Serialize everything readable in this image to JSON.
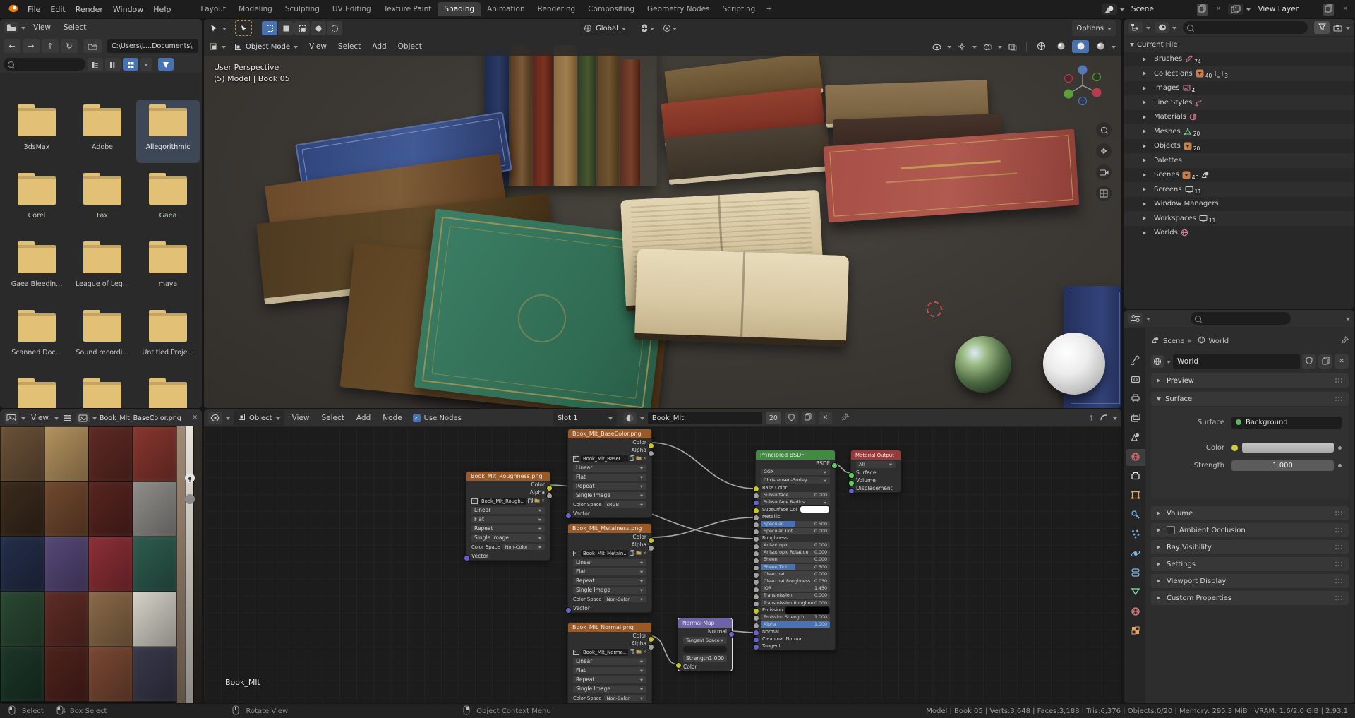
{
  "topbar": {
    "menus": [
      "File",
      "Edit",
      "Render",
      "Window",
      "Help"
    ],
    "workspaces": [
      "Layout",
      "Modeling",
      "Sculpting",
      "UV Editing",
      "Texture Paint",
      "Shading",
      "Animation",
      "Rendering",
      "Compositing",
      "Geometry Nodes",
      "Scripting"
    ],
    "active_workspace": "Shading",
    "add_workspace": "+",
    "scene_value": "Scene",
    "view_layer_value": "View Layer"
  },
  "file_browser": {
    "menus": [
      "View",
      "Select"
    ],
    "path": "C:\\Users\\L...Documents\\",
    "folders": [
      "3dsMax",
      "Adobe",
      "Allegorithmic",
      "Corel",
      "Fax",
      "Gaea",
      "Gaea Bleedin...",
      "League of Leg...",
      "maya",
      "Scanned Doc...",
      "Sound recordi...",
      "Untitled Proje..."
    ],
    "selected_folder": "Allegorithmic",
    "partial_row_count": 3
  },
  "viewport": {
    "mode": "Object Mode",
    "menus": [
      "View",
      "Select",
      "Add",
      "Object"
    ],
    "orientation": "Global",
    "options": "Options",
    "overlay_line1": "User Perspective",
    "overlay_line2": "(5) Model | Book 05"
  },
  "outliner": {
    "root": "Current File",
    "items": [
      {
        "label": "Brushes",
        "badges": [
          {
            "icon": "brush",
            "count": "74"
          }
        ]
      },
      {
        "label": "Collections",
        "badges": [
          {
            "icon": "object-badge",
            "count": "40"
          },
          {
            "icon": "screen",
            "count": "3"
          }
        ]
      },
      {
        "label": "Images",
        "badges": [
          {
            "icon": "image",
            "count": "4"
          }
        ]
      },
      {
        "label": "Line Styles",
        "badges": [
          {
            "icon": "pen",
            "count": ""
          }
        ]
      },
      {
        "label": "Materials",
        "badges": [
          {
            "icon": "material-sphere",
            "count": ""
          }
        ]
      },
      {
        "label": "Meshes",
        "badges": [
          {
            "icon": "mesh",
            "count": "20"
          }
        ]
      },
      {
        "label": "Objects",
        "badges": [
          {
            "icon": "object-badge",
            "count": "20"
          }
        ]
      },
      {
        "label": "Palettes",
        "badges": []
      },
      {
        "label": "Scenes",
        "badges": [
          {
            "icon": "object-badge",
            "count": "40"
          },
          {
            "icon": "scene",
            "count": ""
          }
        ]
      },
      {
        "label": "Screens",
        "badges": [
          {
            "icon": "screen",
            "count": "11"
          }
        ]
      },
      {
        "label": "Window Managers",
        "badges": []
      },
      {
        "label": "Workspaces",
        "badges": [
          {
            "icon": "screen",
            "count": "11"
          }
        ]
      },
      {
        "label": "Worlds",
        "badges": [
          {
            "icon": "world",
            "count": ""
          }
        ]
      }
    ]
  },
  "properties": {
    "tabs": [
      "tool",
      "render",
      "output",
      "view-layer",
      "scene",
      "world",
      "collection",
      "object",
      "modifiers",
      "particles",
      "physics",
      "constraints",
      "object-data",
      "material",
      "texture"
    ],
    "active_tab": "world",
    "breadcrumb": [
      "Scene",
      "World"
    ],
    "datablock": "World",
    "panels": [
      "Preview",
      "Surface",
      "Volume",
      "Ambient Occlusion",
      "Ray Visibility",
      "Settings",
      "Viewport Display",
      "Custom Properties"
    ],
    "expanded_panel": "Surface",
    "surface": {
      "surface_label": "Surface",
      "surface_value": "Background",
      "color_label": "Color",
      "strength_label": "Strength",
      "strength_value": "1.000"
    }
  },
  "image_editor": {
    "menu": "View",
    "image_name": "Book_Mlt_BaseColor.png",
    "atlas_colors": [
      "#6b5138",
      "#b3925e",
      "#5e2a24",
      "#87362e",
      "#3a2a1c",
      "#70482e",
      "#572420",
      "#8f8e8a",
      "#242e4a",
      "#564878",
      "#8c2f36",
      "#2d5c4e",
      "#2a4832",
      "#5e2c26",
      "#8a6a48",
      "#d6d2c8",
      "#1c3628",
      "#4e221c",
      "#7a4834",
      "#38384a"
    ],
    "strip_colors": [
      "#a08a74",
      "#e8e4da",
      "#332e28"
    ]
  },
  "node_editor": {
    "header": {
      "type": "Object",
      "menus": [
        "View",
        "Select",
        "Add",
        "Node"
      ],
      "use_nodes": "Use Nodes",
      "slot": "Slot 1",
      "material": "Book_Mlt",
      "users": "20"
    },
    "canvas_label": "Book_Mlt",
    "tex_dropdowns": [
      "Linear",
      "Flat",
      "Repeat",
      "Single Image"
    ],
    "colorspace_label": "Color Space",
    "tex_outputs": [
      "Color",
      "Alpha"
    ],
    "tex_input": "Vector",
    "tex_nodes": [
      {
        "title": "Book_Mlt_BaseColor.png",
        "image": "Book_Mlt_BaseC..",
        "colorspace": "sRGB"
      },
      {
        "title": "Book_Mlt_Roughness.png",
        "image": "Book_Mlt_Rough..",
        "colorspace": "Non-Color"
      },
      {
        "title": "Book_Mlt_Metalness.png",
        "image": "Book_Mlt_Metaln..",
        "colorspace": "Non-Color"
      },
      {
        "title": "Book_Mlt_Normal.png",
        "image": "Book_Mlt_Norma..",
        "colorspace": "Non-Color"
      }
    ],
    "normal_map": {
      "title": "Normal Map",
      "output": "Normal",
      "space": "Tangent Space",
      "strength_label": "Strength",
      "strength": "1.000",
      "input": "Color"
    },
    "principled": {
      "title": "Principled BSDF",
      "output": "BSDF",
      "distribution": "GGX",
      "subsurface_method": "Christensen-Burley",
      "props": [
        {
          "l": "Base Color",
          "s": "yellow",
          "plain": true
        },
        {
          "l": "Subsurface",
          "v": "0.000",
          "s": "gray"
        },
        {
          "l": "Subsurface Radius",
          "dd": true,
          "s": "purple"
        },
        {
          "l": "Subsurface Col",
          "swatch": "#ffffff",
          "s": "yellow"
        },
        {
          "l": "Metallic",
          "plain": true,
          "s": "gray"
        },
        {
          "l": "Specular",
          "v": "0.500",
          "f": 0.5,
          "s": "gray"
        },
        {
          "l": "Specular Tint",
          "v": "0.000",
          "s": "gray"
        },
        {
          "l": "Roughness",
          "plain": true,
          "s": "gray"
        },
        {
          "l": "Anisotropic",
          "v": "0.000",
          "s": "gray"
        },
        {
          "l": "Anisotropic Rotation",
          "v": "0.000",
          "s": "gray"
        },
        {
          "l": "Sheen",
          "v": "0.000",
          "s": "gray"
        },
        {
          "l": "Sheen Tint",
          "v": "0.500",
          "f": 0.5,
          "s": "gray"
        },
        {
          "l": "Clearcoat",
          "v": "0.000",
          "s": "gray"
        },
        {
          "l": "Clearcoat Roughness",
          "v": "0.030",
          "s": "gray"
        },
        {
          "l": "IOR",
          "v": "1.450",
          "s": "gray"
        },
        {
          "l": "Transmission",
          "v": "0.000",
          "s": "gray"
        },
        {
          "l": "Transmission Roughness",
          "v": "0.000",
          "s": "gray"
        },
        {
          "l": "Emission",
          "swatch": "#000000",
          "s": "yellow"
        },
        {
          "l": "Emission Strength",
          "v": "1.000",
          "s": "gray"
        },
        {
          "l": "Alpha",
          "v": "1.000",
          "f": 1,
          "s": "gray"
        },
        {
          "l": "Normal",
          "plain": true,
          "s": "purple"
        },
        {
          "l": "Clearcoat Normal",
          "plain": true,
          "s": "purple"
        },
        {
          "l": "Tangent",
          "plain": true,
          "s": "purple"
        }
      ]
    },
    "output_node": {
      "title": "Material Output",
      "target": "All",
      "inputs": [
        "Surface",
        "Volume",
        "Displacement"
      ]
    }
  },
  "status_bar": {
    "left": [
      {
        "icon": "mouse-left",
        "label": "Select"
      },
      {
        "icon": "mouse-left-drag",
        "label": "Box Select"
      },
      {
        "icon": "mouse-middle",
        "label": "Rotate View"
      },
      {
        "icon": "mouse-right",
        "label": "Object Context Menu"
      }
    ],
    "right": "Model | Book 05 | Verts:3,648 | Faces:3,188 | Tris:6,376 | Objects:0/20 | Memory: 295.3 MiB | VRAM: 1.6/2.0 GiB | 2.93.1"
  },
  "colors": {
    "accent": "#4772b3",
    "folder": "#e2c176",
    "tex_header": "#9a5a28",
    "bsdf_header": "#3f8b3f",
    "output_header": "#973a3a",
    "normalmap_header": "#6e62a8"
  }
}
